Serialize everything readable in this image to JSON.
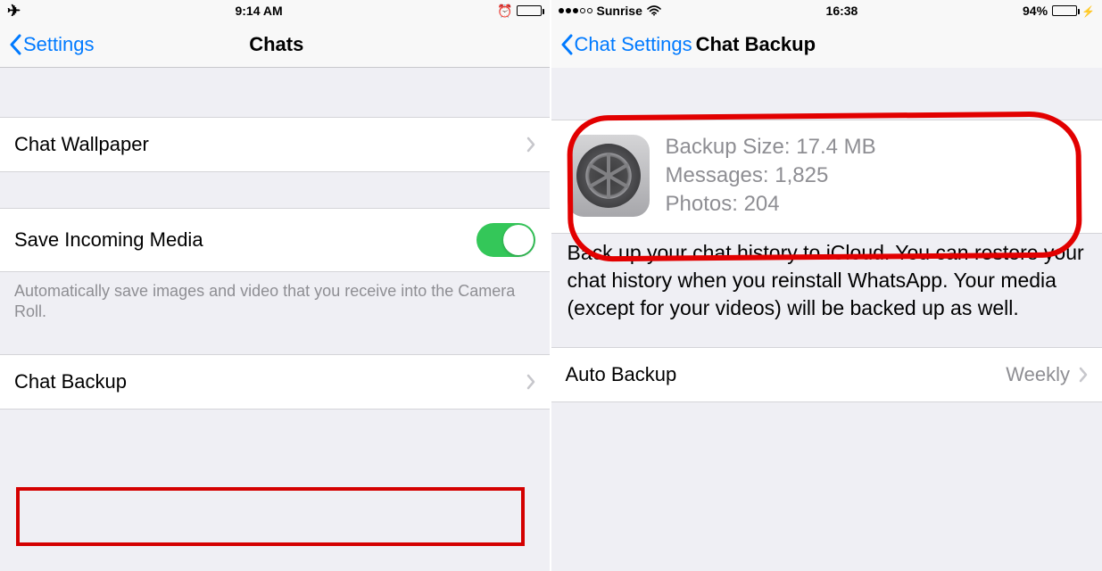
{
  "left": {
    "status": {
      "time": "9:14 AM"
    },
    "nav": {
      "back": "Settings",
      "title": "Chats"
    },
    "rows": {
      "wallpaper": "Chat Wallpaper",
      "save_media": "Save Incoming Media",
      "save_media_footer": "Automatically save images and video that you receive into the Camera Roll.",
      "chat_backup": "Chat Backup"
    }
  },
  "right": {
    "status": {
      "carrier": "Sunrise",
      "time": "16:38",
      "battery": "94%"
    },
    "nav": {
      "back": "Chat Settings",
      "title": "Chat Backup"
    },
    "backup": {
      "size_label": "Backup Size:",
      "size_value": "17.4 MB",
      "messages_label": "Messages:",
      "messages_value": "1,825",
      "photos_label": "Photos:",
      "photos_value": "204"
    },
    "description": "Back up your chat history to iCloud. You can restore your chat history when you reinstall WhatsApp. Your media (except for your videos) will be backed up as well.",
    "auto_backup": {
      "label": "Auto Backup",
      "value": "Weekly"
    }
  }
}
